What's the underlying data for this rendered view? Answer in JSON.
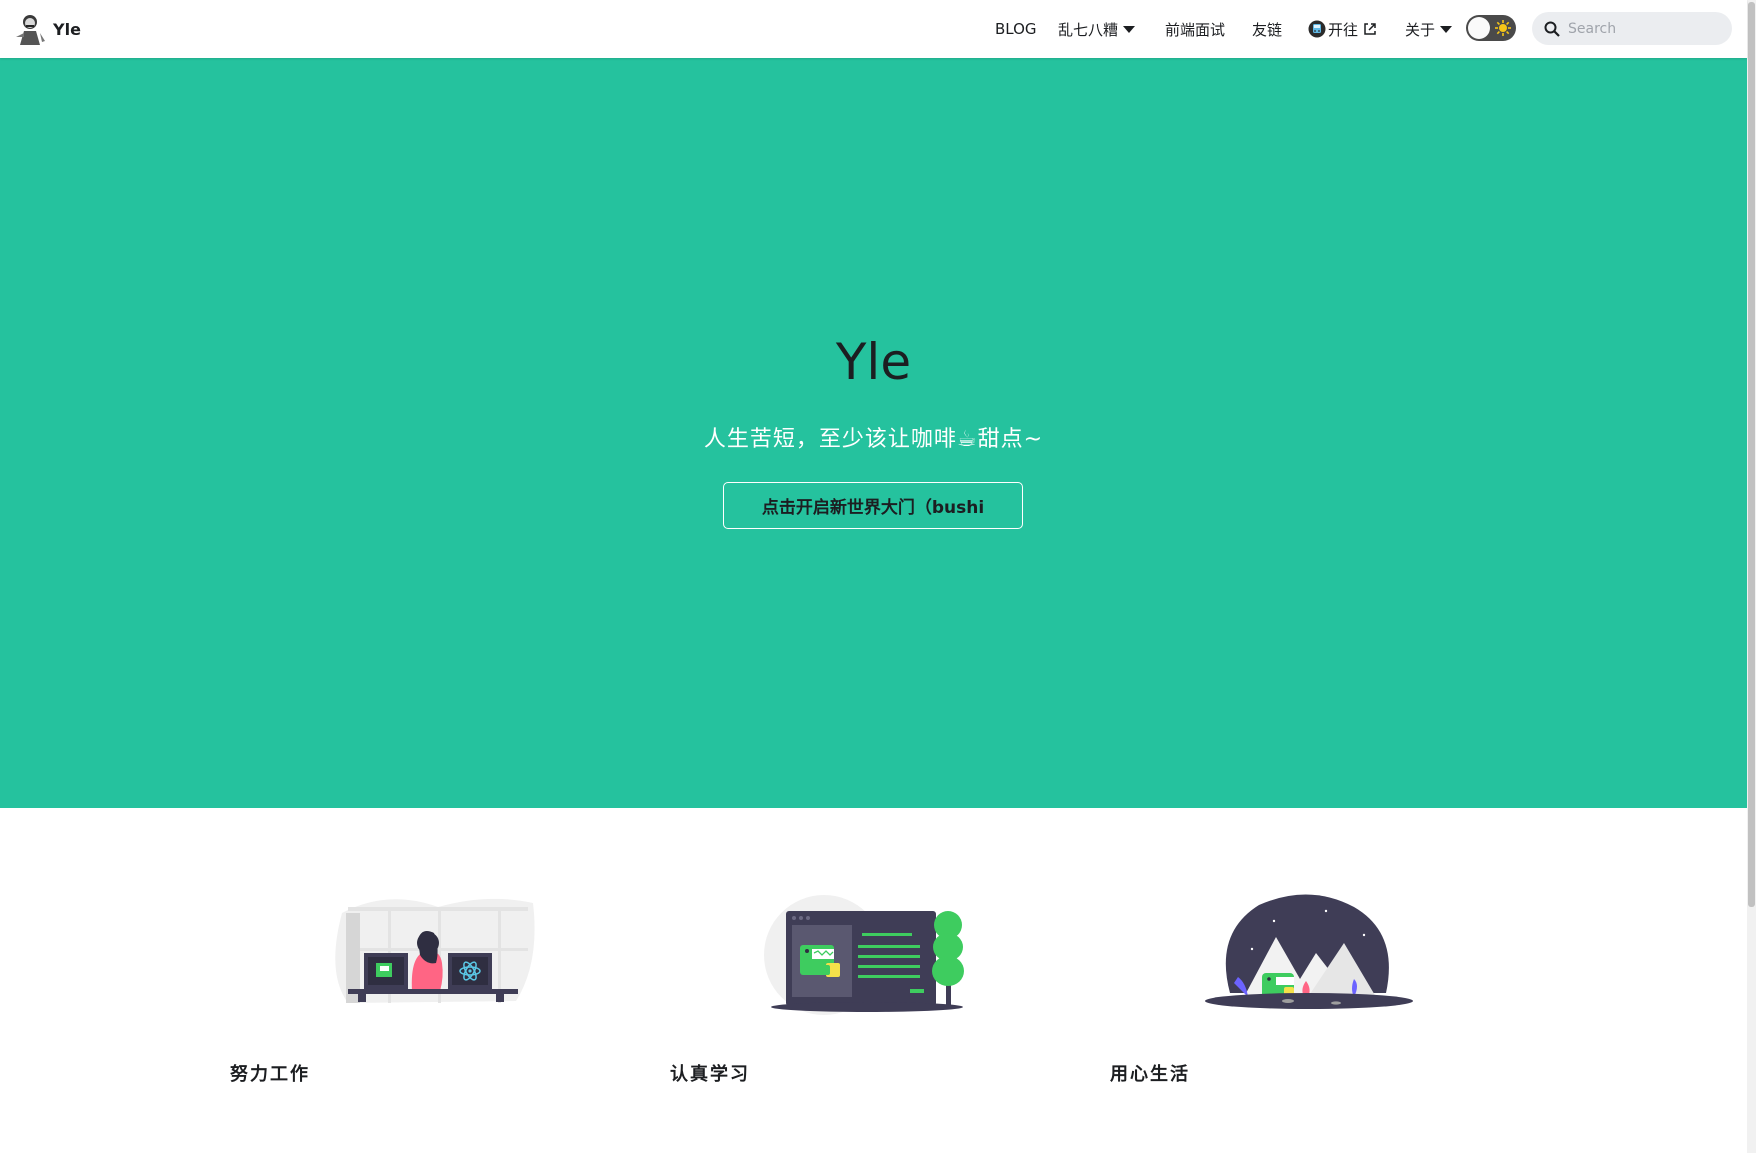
{
  "navbar": {
    "brand_title": "Yle",
    "items": {
      "blog": "BLOG",
      "misc": "乱七八糟",
      "interview": "前端面试",
      "links": "友链",
      "travel": "开往",
      "about": "关于"
    },
    "search_placeholder": "Search"
  },
  "hero": {
    "title": "Yle",
    "subtitle": "人生苦短，至少该让咖啡☕甜点~",
    "button_label": "点击开启新世界大门（bushi"
  },
  "features": [
    {
      "label": "努力工作"
    },
    {
      "label": "认真学习"
    },
    {
      "label": "用心生活"
    }
  ],
  "colors": {
    "hero_bg": "#25c29e",
    "accent_green": "#3ecc5f",
    "dark_illustration": "#3f3d56"
  }
}
